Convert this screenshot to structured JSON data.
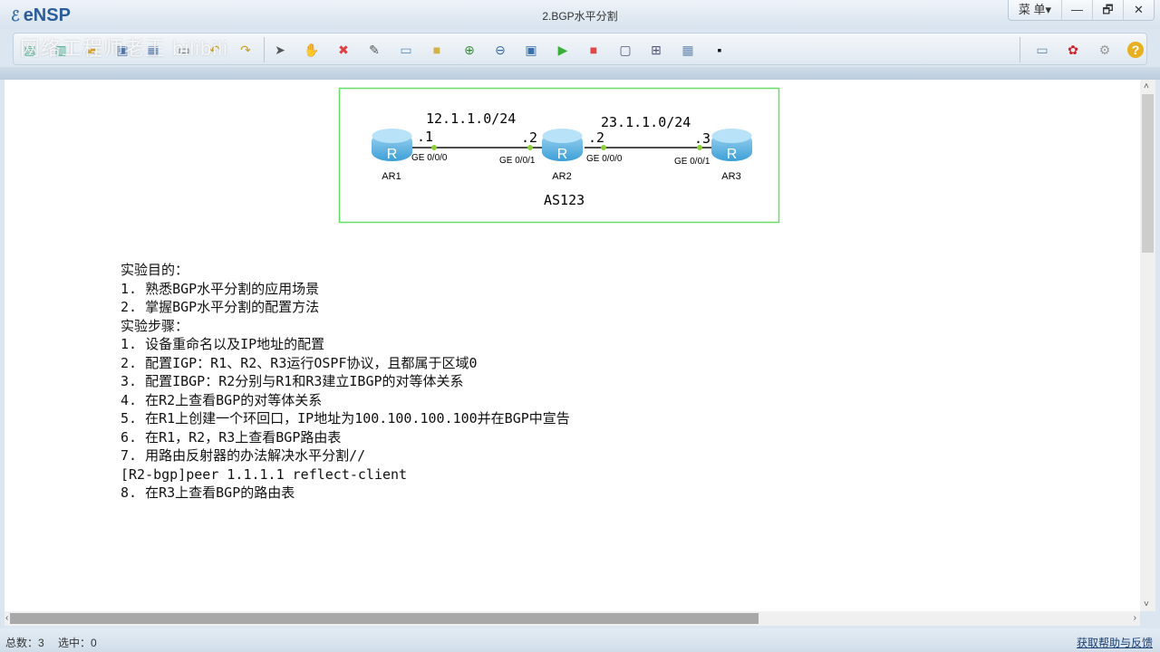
{
  "app": {
    "name": "eNSP",
    "window_title": "2.BGP水平分割",
    "menu_label": "菜 单▾",
    "minimize": "—",
    "restore": "🗗",
    "close": "✕"
  },
  "watermark": "网络工程师老王 bilibili",
  "toolbar": {
    "left_icons": [
      "new-topology-icon",
      "new-lab-icon",
      "open-icon",
      "save-icon",
      "save-as-icon",
      "print-icon",
      "undo-icon",
      "redo-icon",
      "select-icon",
      "pan-hand-icon",
      "delete-icon",
      "delete-link-icon",
      "text-note-icon",
      "rectangle-icon",
      "zoom-in-icon",
      "zoom-out-icon",
      "fit-icon",
      "start-device-icon",
      "stop-device-icon",
      "capture-icon",
      "topology-icon",
      "grid-icon",
      "terminal-icon"
    ],
    "right_icons": [
      "chat-icon",
      "huawei-icon",
      "settings-icon",
      "help-icon"
    ]
  },
  "topology": {
    "routers": [
      {
        "name": "AR1"
      },
      {
        "name": "AR2"
      },
      {
        "name": "AR3"
      }
    ],
    "links": [
      {
        "subnet": "12.1.1.0/24",
        "a_ip": ".1",
        "a_if": "GE 0/0/0",
        "b_ip": ".2",
        "b_if": "GE 0/0/1"
      },
      {
        "subnet": "23.1.1.0/24",
        "a_ip": ".2",
        "a_if": "GE 0/0/0",
        "b_ip": ".3",
        "b_if": "GE 0/0/1"
      }
    ],
    "as_label": "AS123",
    "border_color": "#66dd66"
  },
  "notes": [
    "实验目的：",
    "1. 熟悉BGP水平分割的应用场景",
    "2. 掌握BGP水平分割的配置方法",
    "实验步骤：",
    "1. 设备重命名以及IP地址的配置",
    "2. 配置IGP：R1、R2、R3运行OSPF协议，且都属于区域0",
    "3. 配置IBGP：R2分别与R1和R3建立IBGP的对等体关系",
    "4. 在R2上查看BGP的对等体关系",
    "5. 在R1上创建一个环回口，IP地址为100.100.100.100并在BGP中宣告",
    "6. 在R1，R2，R3上查看BGP路由表",
    "7. 用路由反射器的办法解决水平分割//",
    "[R2-bgp]peer 1.1.1.1 reflect-client",
    "8. 在R3上查看BGP的路由表"
  ],
  "status": {
    "total": "总数：3",
    "selected": "选中：0",
    "help_link": "获取帮助与反馈"
  }
}
